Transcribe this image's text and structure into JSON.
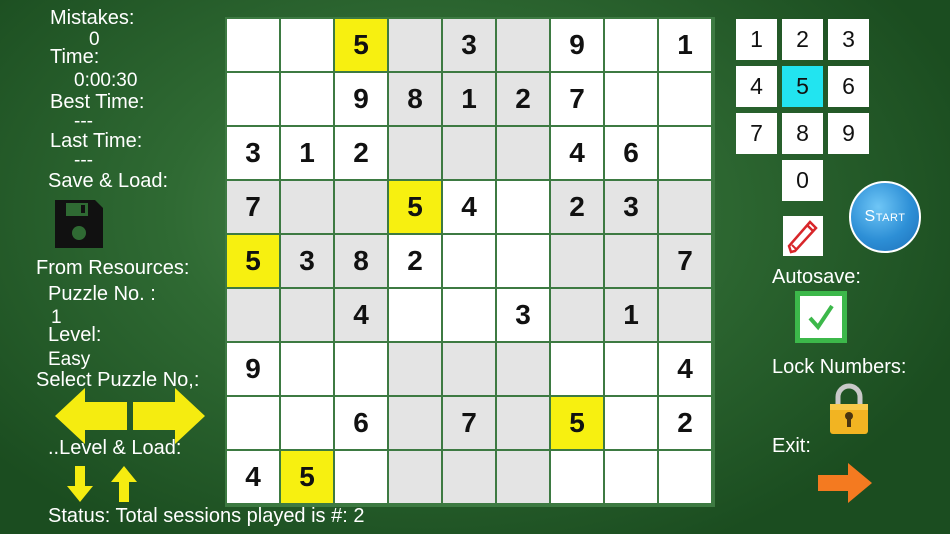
{
  "left_panel": {
    "mistakes_label": "Mistakes:",
    "mistakes_value": "0",
    "time_label": "Time:",
    "time_value": "0:00:30",
    "best_time_label": "Best Time:",
    "best_time_value": "---",
    "last_time_label": "Last Time:",
    "last_time_value": "---",
    "save_load_label": "Save & Load:",
    "from_resources_label": "From Resources:",
    "puzzle_no_label": "Puzzle No. :",
    "puzzle_no_value": "1",
    "level_label": "Level:",
    "level_value": "Easy",
    "select_puzzle_label": "Select Puzzle No,:",
    "level_load_label": "..Level & Load:",
    "status_text": "Status: Total sessions played is #: 2"
  },
  "board": {
    "rows": [
      [
        "",
        "",
        "5",
        "",
        "3",
        "",
        "9",
        "",
        "1"
      ],
      [
        "",
        "",
        "9",
        "8",
        "1",
        "2",
        "7",
        "",
        ""
      ],
      [
        "3",
        "1",
        "2",
        "",
        "",
        "",
        "4",
        "6",
        ""
      ],
      [
        "7",
        "",
        "",
        "5",
        "4",
        "",
        "2",
        "3",
        ""
      ],
      [
        "5",
        "3",
        "8",
        "2",
        "",
        "",
        "",
        "",
        "7"
      ],
      [
        "",
        "",
        "4",
        "",
        "",
        "3",
        "",
        "1",
        ""
      ],
      [
        "9",
        "",
        "",
        "",
        "",
        "",
        "",
        "",
        "4"
      ],
      [
        "",
        "",
        "6",
        "",
        "7",
        "",
        "5",
        "",
        "2"
      ],
      [
        "4",
        "5",
        "",
        "",
        "",
        "",
        "",
        "",
        ""
      ]
    ],
    "highlighted_digit": "5",
    "highlight_color": "#f7f010",
    "shade_color": "#e4e4e4"
  },
  "number_pad": {
    "digits": [
      "1",
      "2",
      "3",
      "4",
      "5",
      "6",
      "7",
      "8",
      "9",
      "0"
    ],
    "selected": "5",
    "selected_color": "#22e4f0"
  },
  "right_panel": {
    "start_label": "Start",
    "autosave_label": "Autosave:",
    "autosave_checked": true,
    "lock_numbers_label": "Lock Numbers:",
    "exit_label": "Exit:"
  },
  "icons": {
    "save": "floppy-disk-icon",
    "pencil": "pencil-icon",
    "lock": "padlock-icon",
    "exit": "arrow-right-icon",
    "prev": "arrow-left-icon",
    "next": "arrow-right-icon",
    "level_down": "arrow-down-icon",
    "level_up": "arrow-up-icon"
  },
  "colors": {
    "arrow_yellow": "#f5ec10",
    "exit_orange": "#f47a20",
    "start_blue": "#2d8fd6",
    "check_green": "#3cb84a"
  }
}
